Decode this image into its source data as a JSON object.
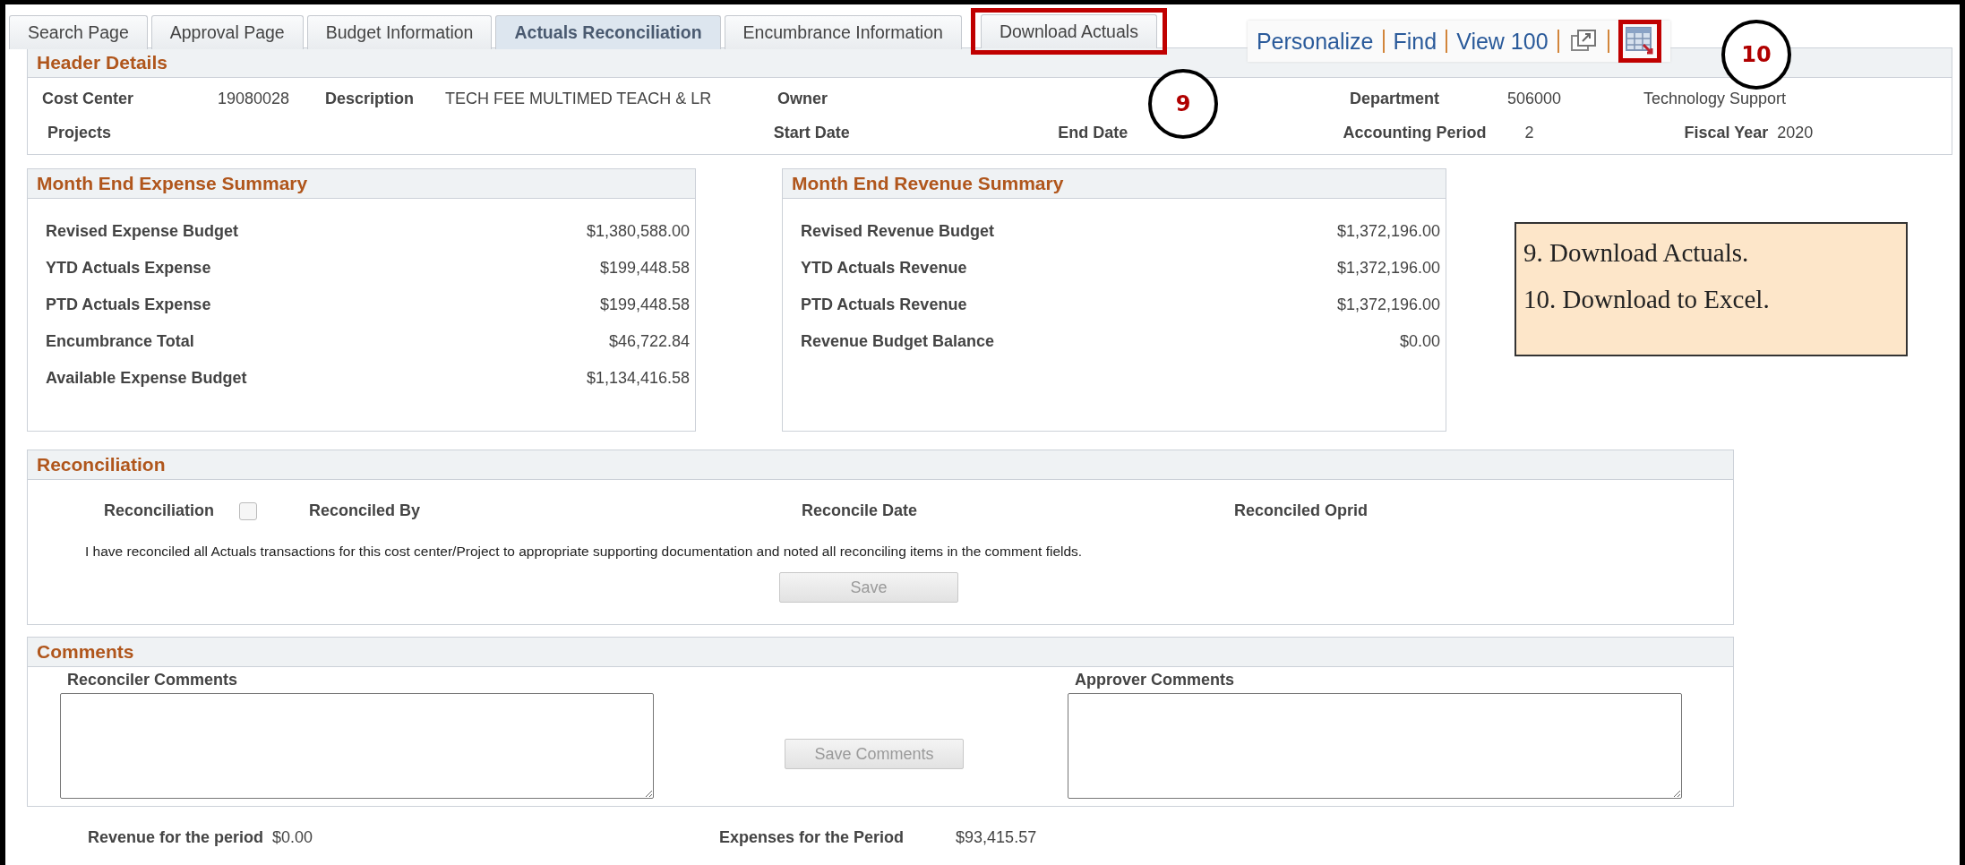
{
  "tabs": [
    {
      "label": "Search Page",
      "selected": false,
      "highlighted": false
    },
    {
      "label": "Approval Page",
      "selected": false,
      "highlighted": false
    },
    {
      "label": "Budget Information",
      "selected": false,
      "highlighted": false
    },
    {
      "label": "Actuals Reconciliation",
      "selected": true,
      "highlighted": false
    },
    {
      "label": "Encumbrance Information",
      "selected": false,
      "highlighted": false
    },
    {
      "label": "Download Actuals",
      "selected": false,
      "highlighted": true
    }
  ],
  "grid_toolbar": {
    "links": [
      "Personalize",
      "Find",
      "View 100"
    ],
    "icons": [
      {
        "kind": "new-window",
        "highlighted": false
      },
      {
        "kind": "spreadsheet",
        "highlighted": true
      }
    ]
  },
  "callout_markers": [
    "9",
    "10"
  ],
  "header_details": {
    "title": "Header Details",
    "rows": [
      [
        {
          "label": "Cost Center",
          "value": "19080028"
        },
        {
          "label": "Description",
          "value": "TECH FEE MULTIMED TEACH & LR"
        },
        {
          "label": "Owner"
        },
        "",
        {
          "label": "Department",
          "value": "506000"
        },
        {
          "value": "Technology Support"
        }
      ],
      [
        {
          "label": "Projects"
        },
        "",
        {
          "label": "Start Date"
        },
        {
          "label": "End Date"
        },
        {
          "label": "Accounting Period",
          "value": "2"
        },
        {
          "label": "Fiscal Year",
          "value": "2020"
        }
      ]
    ]
  },
  "summaries": [
    {
      "title": "Month End Expense Summary",
      "rows": [
        {
          "label": "Revised Expense Budget",
          "value": "$1,380,588.00"
        },
        {
          "label": "YTD Actuals Expense",
          "value": "$199,448.58"
        },
        {
          "label": "PTD Actuals Expense",
          "value": "$199,448.58"
        },
        {
          "label": "Encumbrance Total",
          "value": "$46,722.84"
        },
        {
          "label": "Available Expense Budget",
          "value": "$1,134,416.58"
        }
      ]
    },
    {
      "title": "Month End Revenue Summary",
      "rows": [
        {
          "label": "Revised Revenue Budget",
          "value": "$1,372,196.00"
        },
        {
          "label": "YTD Actuals Revenue",
          "value": "$1,372,196.00"
        },
        {
          "label": "PTD Actuals Revenue",
          "value": "$1,372,196.00"
        },
        {
          "label": "Revenue Budget Balance",
          "value": "$0.00"
        }
      ]
    }
  ],
  "callout_note": [
    "9. Download Actuals.",
    "10. Download to Excel."
  ],
  "reconciliation": {
    "title": "Reconciliation",
    "checkbox": {
      "label": "Reconciliation",
      "checked": false
    },
    "fields": [
      "Reconciled By",
      "Reconcile Date",
      "Reconciled Oprid"
    ],
    "statement": "I have reconciled all Actuals transactions for this cost center/Project to appropriate supporting documentation and noted all reconciling items in the comment fields.",
    "button": {
      "label": "Save",
      "disabled": true
    }
  },
  "comments": {
    "title": "Comments",
    "reconciler_label": "Reconciler Comments",
    "approver_label": "Approver Comments",
    "button": {
      "label": "Save Comments",
      "disabled": true
    }
  },
  "footer": [
    {
      "label": "Revenue for the period",
      "value": "$0.00"
    },
    {
      "label": "Expenses for the Period",
      "value": "$93,415.57"
    }
  ]
}
